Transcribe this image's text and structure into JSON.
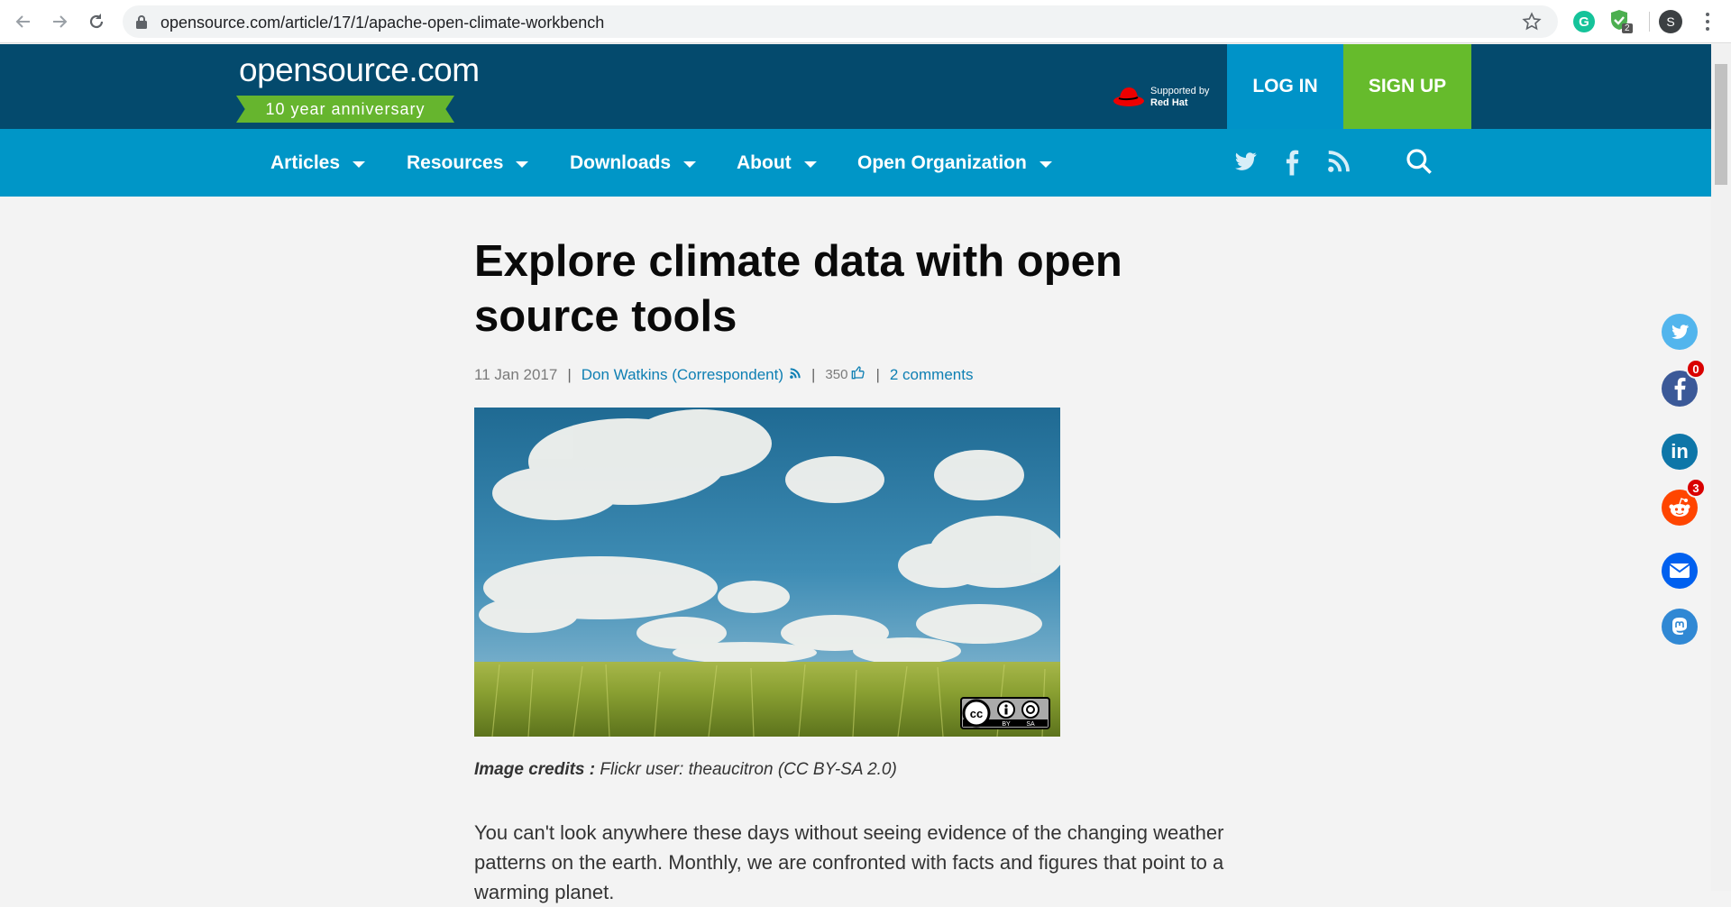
{
  "browser": {
    "url": "opensource.com/article/17/1/apache-open-climate-workbench",
    "extension_badge": "2",
    "grammarly_letter": "G",
    "profile_initial": "S"
  },
  "header": {
    "logo_text": "opensource.com",
    "anniversary": "10 year anniversary",
    "supported_by": "Supported by",
    "sponsor": "Red Hat",
    "login_label": "LOG IN",
    "signup_label": "SIGN UP"
  },
  "nav": {
    "items": [
      {
        "label": "Articles"
      },
      {
        "label": "Resources"
      },
      {
        "label": "Downloads"
      },
      {
        "label": "About"
      },
      {
        "label": "Open Organization"
      }
    ],
    "social_icons": [
      "twitter-icon",
      "facebook-icon",
      "rss-icon",
      "search-icon"
    ]
  },
  "article": {
    "title": "Explore climate data with open source tools",
    "date": "11 Jan 2017",
    "author": "Don Watkins (Correspondent)",
    "likes": "350",
    "comments": "2 comments",
    "image_credit_label": "Image credits :",
    "image_credit_text": "Flickr user: theaucitron (CC BY-SA 2.0)",
    "license_badge": {
      "by": "BY",
      "sa": "SA"
    },
    "body": "You can't look anywhere these days without seeing evidence of the changing weather patterns on the earth. Monthly, we are confronted with facts and figures that point to a warming planet."
  },
  "share": {
    "facebook_count": "0",
    "reddit_count": "3"
  },
  "colors": {
    "header_dark": "#044a6d",
    "nav_blue": "#0096c7",
    "login_blue": "#0093c8",
    "signup_green": "#66bb2c",
    "link_blue": "#0e7fb3"
  }
}
